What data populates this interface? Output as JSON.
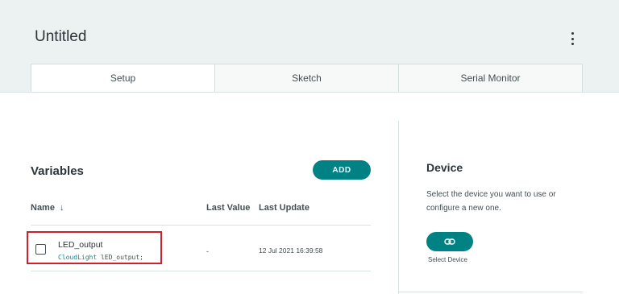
{
  "header": {
    "title": "Untitled",
    "menu_icon": "kebab-menu-icon"
  },
  "tabs": [
    {
      "label": "Setup",
      "active": true
    },
    {
      "label": "Sketch",
      "active": false
    },
    {
      "label": "Serial Monitor",
      "active": false
    }
  ],
  "variables": {
    "title": "Variables",
    "add_label": "ADD",
    "columns": {
      "name": "Name",
      "name_sort_icon": "arrow-down-icon",
      "last_value": "Last Value",
      "last_update": "Last Update"
    },
    "rows": [
      {
        "name": "LED_output",
        "type_keyword": "CloudLight",
        "declaration_rest": " lED_output;",
        "last_value": "-",
        "last_update": "12 Jul 2021 16:39:58"
      }
    ]
  },
  "device": {
    "title": "Device",
    "description": "Select the device you want to use or configure a new one.",
    "button_icon": "link-icon",
    "select_label": "Select Device"
  },
  "colors": {
    "accent": "#008184",
    "header_bg": "#ecf1f1",
    "highlight": "#d0202d"
  }
}
